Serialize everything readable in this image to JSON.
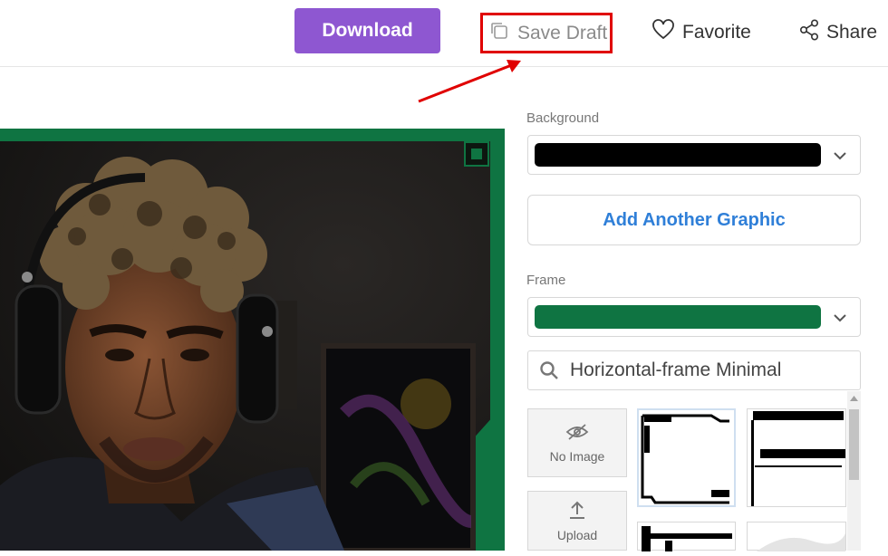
{
  "toolbar": {
    "download_label": "Download",
    "save_draft_label": "Save Draft",
    "favorite_label": "Favorite",
    "share_label": "Share"
  },
  "panel": {
    "background_label": "Background",
    "background_color": "#000000",
    "add_graphic_label": "Add Another Graphic",
    "frame_label": "Frame",
    "frame_color": "#0f7442",
    "search_value": "Horizontal-frame Minimal",
    "no_image_label": "No Image",
    "upload_label": "Upload"
  },
  "colors": {
    "accent": "#8e57d1",
    "link": "#2f7fd8",
    "highlight": "#e00000"
  },
  "icons": [
    "copy-icon",
    "heart-icon",
    "share-icon",
    "search-icon",
    "eye-off-icon",
    "upload-icon",
    "chevron-down-icon"
  ]
}
